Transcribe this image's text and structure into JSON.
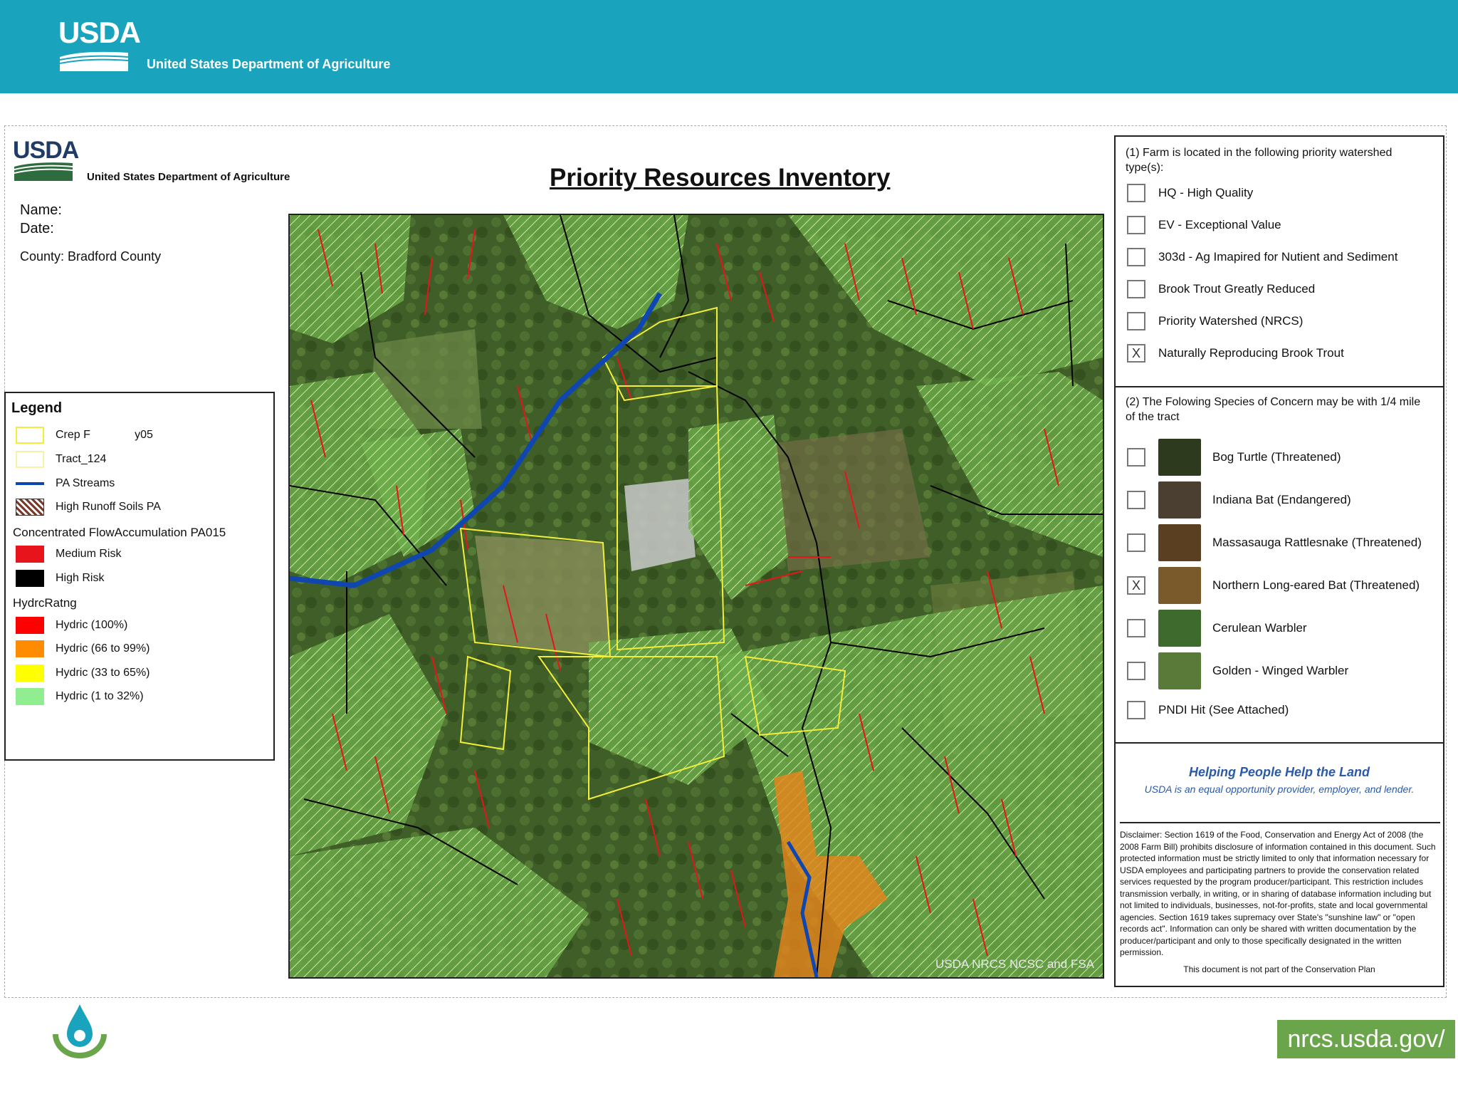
{
  "banner": {
    "logo_text": "USDA",
    "department": "United States Department of Agriculture"
  },
  "document": {
    "logo_text": "USDA",
    "department": "United States Department of Agriculture",
    "title": "Priority Resources Inventory",
    "name_label": "Name:",
    "date_label": "Date:",
    "county_label": "County: Bradford County"
  },
  "legend": {
    "title": "Legend",
    "items": [
      {
        "label": "Crep F              y05",
        "swatch": "outline-yellow"
      },
      {
        "label": "Tract_124",
        "swatch": "outline-pale-yellow"
      },
      {
        "label": "PA Streams",
        "swatch": "blue-line"
      },
      {
        "label": "High Runoff Soils PA",
        "swatch": "hatched"
      }
    ],
    "group1_title": "Concentrated FlowAccumulation PA015",
    "group1_items": [
      {
        "label": "Medium Risk",
        "color": "#e8141b"
      },
      {
        "label": "High Risk",
        "color": "#000000"
      }
    ],
    "group2_title": "HydrcRatng",
    "group2_items": [
      {
        "label": "Hydric (100%)",
        "color": "#ff0000"
      },
      {
        "label": "Hydric (66 to 99%)",
        "color": "#ff8c00"
      },
      {
        "label": "Hydric (33 to 65%)",
        "color": "#ffff00"
      },
      {
        "label": "Hydric (1 to 32%)",
        "color": "#90ee90"
      }
    ]
  },
  "map": {
    "credit": "USDA NRCS NCSC and FSA"
  },
  "panel": {
    "section1_heading": "(1) Farm is located in the following priority watershed type(s):",
    "watersheds": [
      {
        "label": "HQ - High Quality",
        "mark": ""
      },
      {
        "label": "EV - Exceptional Value",
        "mark": ""
      },
      {
        "label": "303d - Ag Imapired for Nutient and Sediment",
        "mark": ""
      },
      {
        "label": "Brook Trout Greatly Reduced",
        "mark": ""
      },
      {
        "label": "Priority Watershed (NRCS)",
        "mark": ""
      },
      {
        "label": "Naturally Reproducing Brook Trout",
        "mark": "X"
      }
    ],
    "section2_heading": "(2) The Folowing Species of Concern may be with 1/4 mile of the tract",
    "species": [
      {
        "label": "Bog Turtle (Threatened)",
        "mark": ""
      },
      {
        "label": "Indiana Bat (Endangered)",
        "mark": ""
      },
      {
        "label": "Massasauga Rattlesnake (Threatened)",
        "mark": ""
      },
      {
        "label": "Northern Long-eared Bat (Threatened)",
        "mark": "X"
      },
      {
        "label": "Cerulean Warbler",
        "mark": ""
      },
      {
        "label": "Golden - Winged Warbler",
        "mark": ""
      }
    ],
    "pndi": {
      "label": "PNDI Hit (See Attached)",
      "mark": ""
    },
    "helping": "Helping People Help the Land",
    "equal": "USDA is an equal opportunity provider, employer, and lender.",
    "disclaimer": "Disclaimer: Section 1619 of the Food, Conservation and Energy Act of 2008 (the 2008 Farm Bill) prohibits disclosure of information contained in this document. Such protected information must be strictly limited to only that information necessary for USDA employees and participating partners to provide the conservation related services requested by the program producer/participant. This restriction includes transmission verbally, in writing, or in sharing of database information including but not limited to individuals, businesses, not-for-profits, state and local governmental agencies. Section 1619 takes supremacy over State's \"sunshine law\" or \"open records act\". Information can only be shared with written documentation by the producer/participant and only to those specifically designated in the written permission.",
    "not_part": "This document is not part of the Conservation Plan"
  },
  "footer": {
    "link": "nrcs.usda.gov/"
  }
}
